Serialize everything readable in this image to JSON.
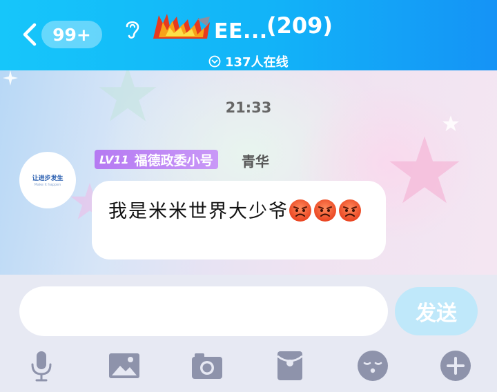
{
  "header": {
    "unread_badge": "99+",
    "title": "EE...",
    "member_count": "(209)",
    "online_text": "137人在线",
    "logo_name": "group-logo-flame"
  },
  "chat": {
    "timestamp": "21:33",
    "message": {
      "avatar_text": "让进步发生",
      "avatar_subtext": "Make it happen",
      "level": "LV11",
      "title_tag": "福德政委小号",
      "nickname": "青华",
      "text": "我是米米世界大少爷",
      "emojis": [
        "angry-face",
        "angry-face",
        "angry-face"
      ]
    }
  },
  "input": {
    "value": "",
    "placeholder": "",
    "send_label": "发送"
  },
  "toolbar": {
    "items": [
      "microphone-icon",
      "image-icon",
      "camera-icon",
      "red-packet-icon",
      "emoji-icon",
      "plus-icon"
    ]
  },
  "colors": {
    "header_start": "#16c6fa",
    "header_end": "#1593f6",
    "level_tag": "#b57af2",
    "send_button": "#bfe8fa",
    "toolbar_icon": "#8e93ab"
  }
}
